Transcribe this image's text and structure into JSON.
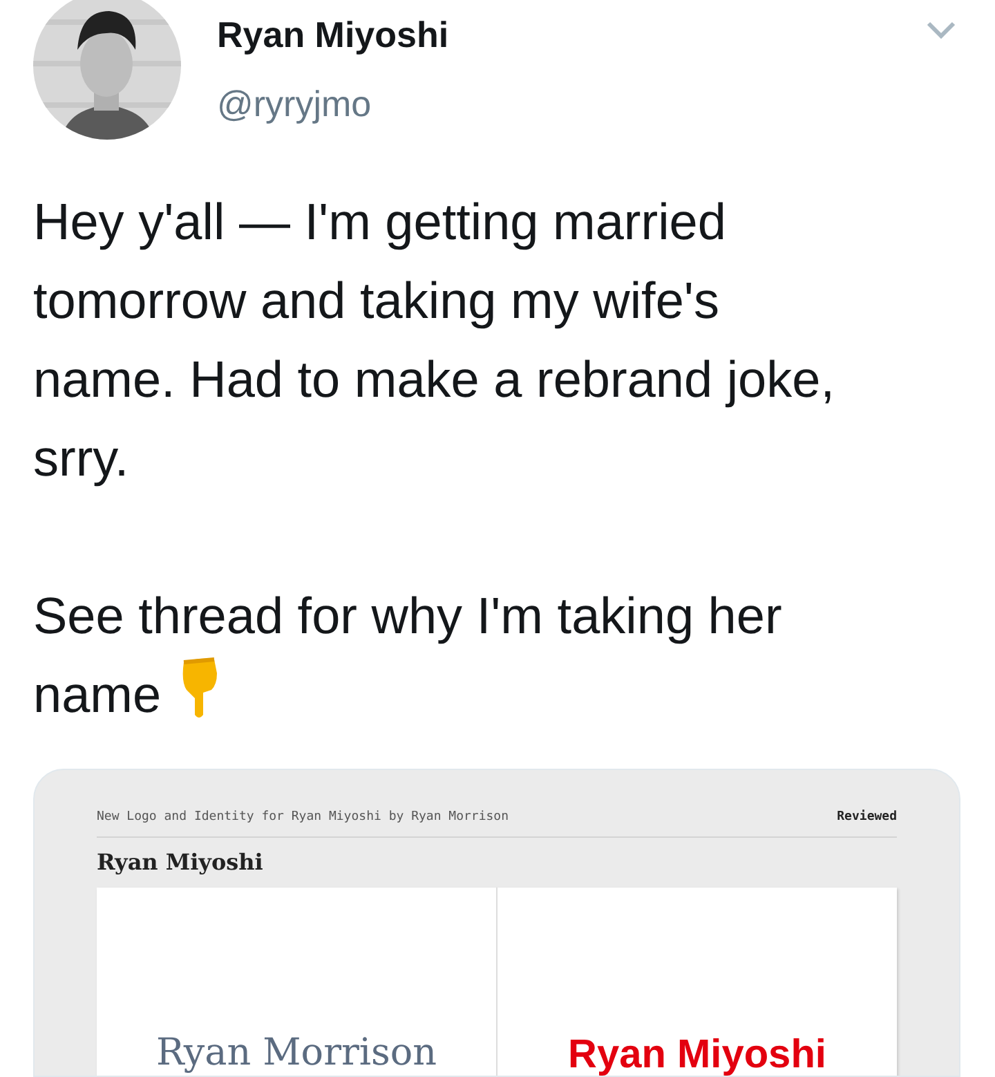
{
  "author": {
    "name": "Ryan Miyoshi",
    "handle": "@ryryjmo"
  },
  "tweet": {
    "paragraphs": [
      "Hey y'all — I'm getting married tomorrow and taking my wife's name. Had to make a rebrand joke, srry.",
      "See thread for why I'm taking her name"
    ]
  },
  "card": {
    "header": "New Logo and Identity for Ryan Miyoshi by Ryan Morrison",
    "badge": "Reviewed",
    "title": "Ryan Miyoshi",
    "panels": [
      {
        "kind": "old",
        "logo_text": "Ryan Morrison"
      },
      {
        "kind": "new",
        "logo_text": "Ryan Miyoshi"
      }
    ]
  }
}
